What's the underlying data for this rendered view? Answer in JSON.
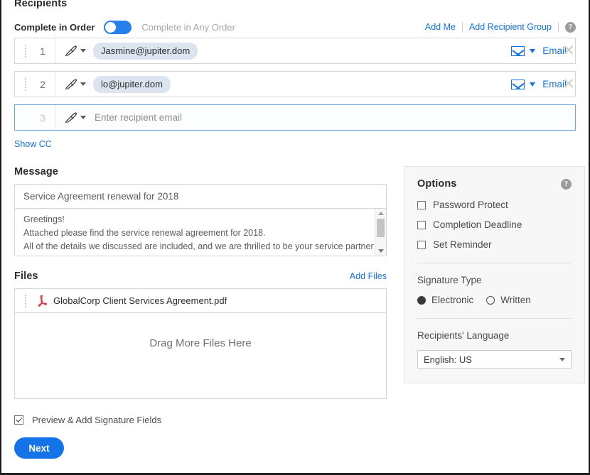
{
  "recipients": {
    "title": "Recipients",
    "order_toggle": {
      "on_label": "Complete in Order",
      "off_label": "Complete in Any Order",
      "state": "in-order"
    },
    "links": {
      "add_me": "Add Me",
      "add_recipient_group": "Add Recipient Group",
      "help": "?"
    },
    "rows": [
      {
        "number": "1",
        "email": "Jasmine@jupiter.dom",
        "delivery": "Email",
        "placeholder": "",
        "focused": false
      },
      {
        "number": "2",
        "email": "lo@jupiter.dom",
        "delivery": "Email",
        "placeholder": "",
        "focused": false
      },
      {
        "number": "3",
        "email": "",
        "delivery": "",
        "placeholder": "Enter recipient email",
        "focused": true
      }
    ],
    "show_cc": "Show CC"
  },
  "message": {
    "title": "Message",
    "subject": "Service Agreement renewal for 2018",
    "body_lines": [
      "Greetings!",
      "Attached please find the service renewal agreement for 2018.",
      "All of the details we discussed are included, and we are thrilled to be your service partner for"
    ]
  },
  "files": {
    "title": "Files",
    "add_files": "Add Files",
    "items": [
      {
        "name": "GlobalCorp Client Services Agreement.pdf",
        "type": "pdf"
      }
    ],
    "dropzone_text": "Drag More Files Here"
  },
  "options": {
    "title": "Options",
    "help": "?",
    "checkboxes": [
      {
        "label": "Password Protect",
        "checked": false
      },
      {
        "label": "Completion Deadline",
        "checked": false
      },
      {
        "label": "Set Reminder",
        "checked": false
      }
    ],
    "signature_type": {
      "label": "Signature Type",
      "choices": [
        {
          "label": "Electronic",
          "selected": true
        },
        {
          "label": "Written",
          "selected": false
        }
      ]
    },
    "language": {
      "label": "Recipients' Language",
      "selected": "English: US"
    }
  },
  "footer": {
    "preview_label": "Preview & Add Signature Fields",
    "preview_checked": true,
    "next_label": "Next"
  },
  "colors": {
    "accent_blue": "#1473e6",
    "toggle_blue": "#2680eb",
    "chip_bg": "#dce5ef",
    "panel_bg": "#f7f7f7",
    "pdf_red": "#d8414a"
  }
}
